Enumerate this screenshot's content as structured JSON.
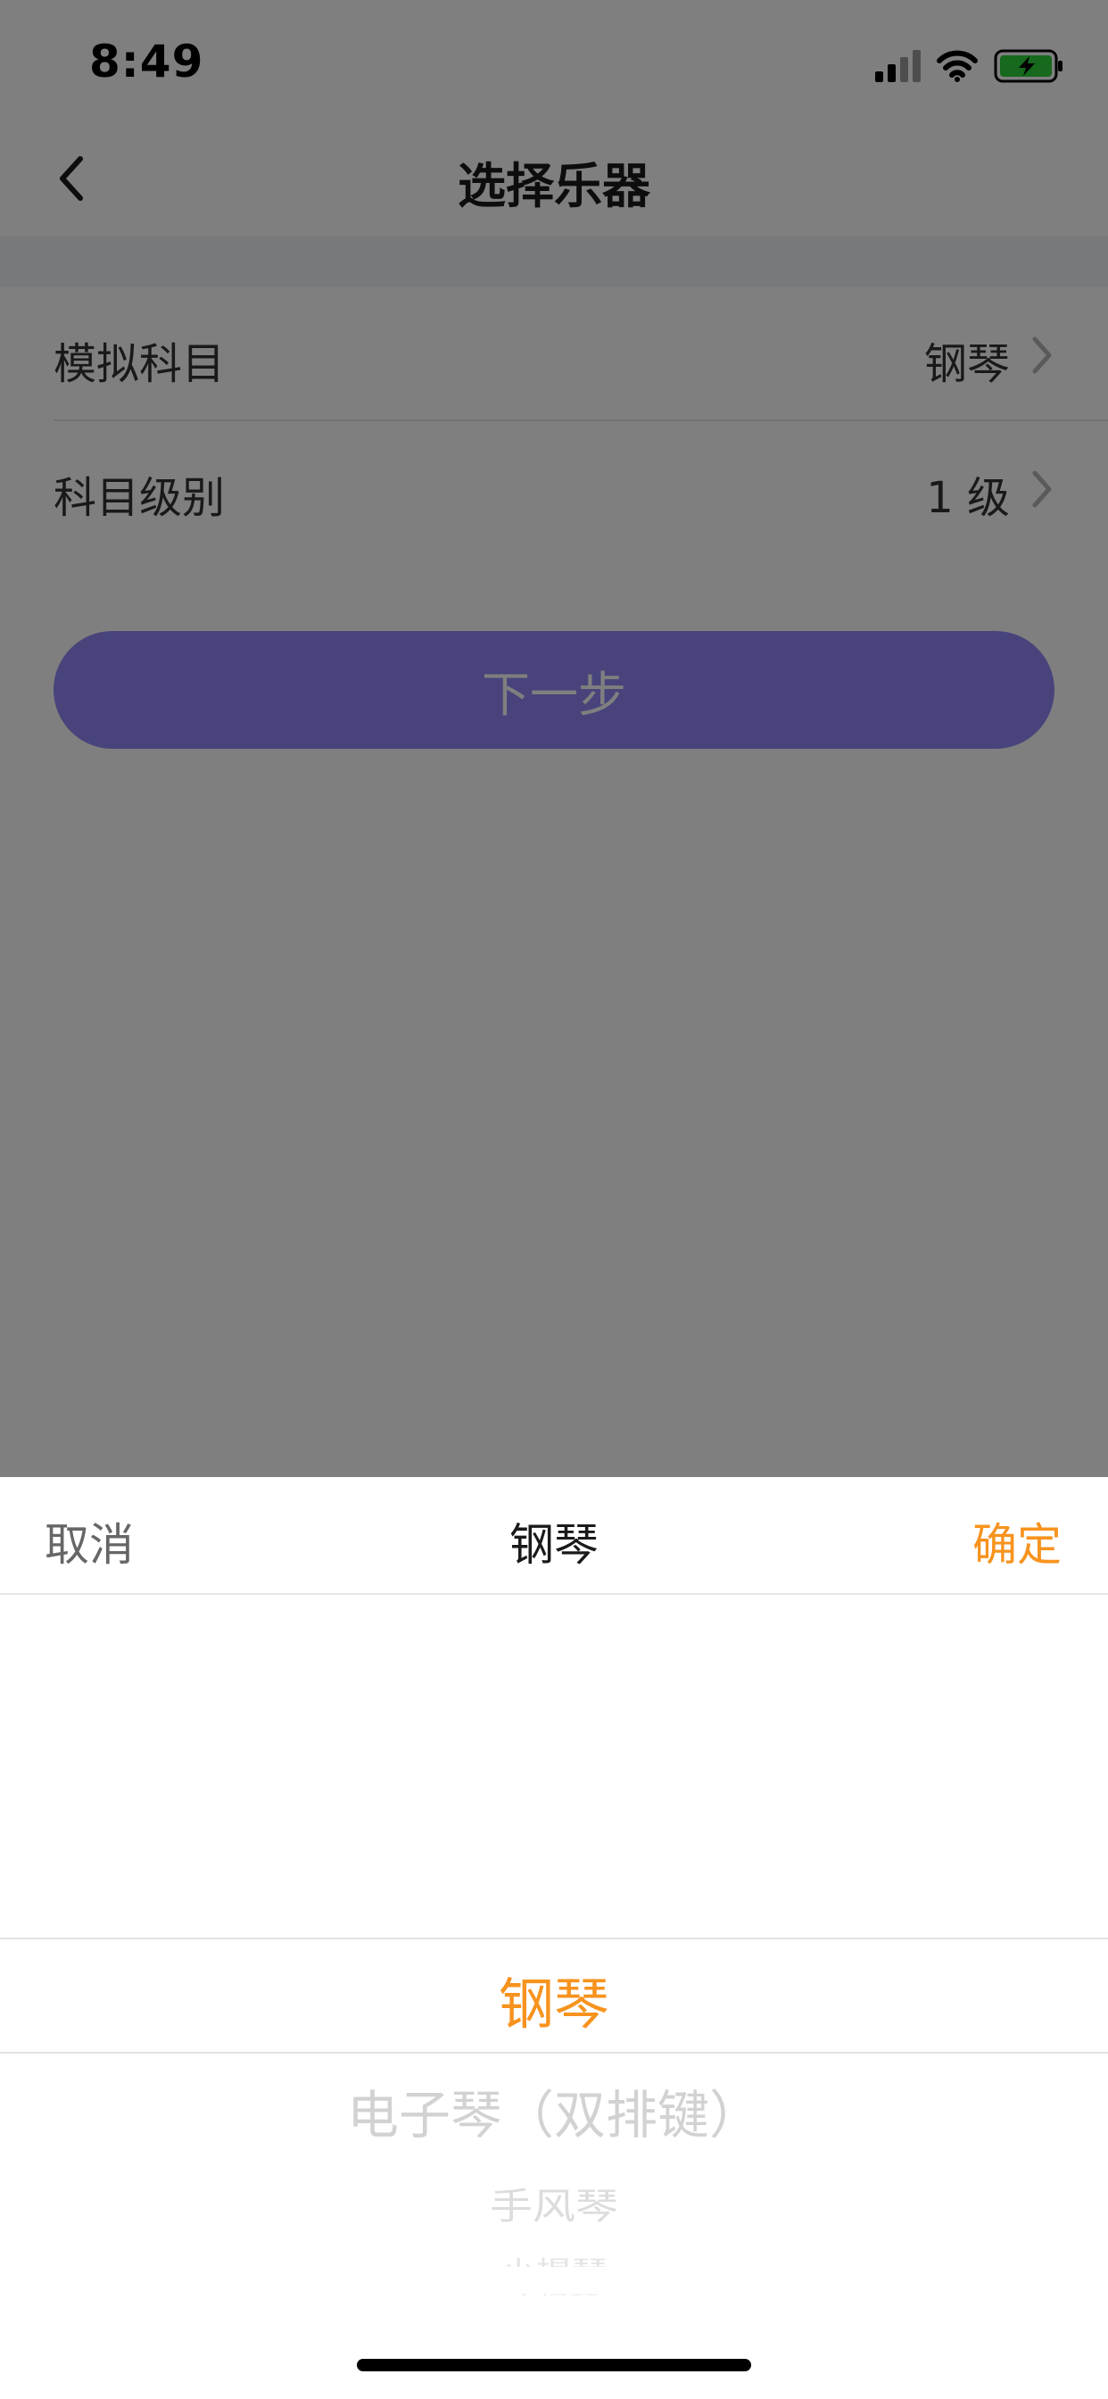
{
  "status_bar": {
    "time": "8:49",
    "battery_color": "#2dd23a"
  },
  "nav": {
    "title": "选择乐器",
    "back_icon": "chevron-left-icon"
  },
  "form": {
    "rows": [
      {
        "label": "模拟科目",
        "value": "钢琴"
      },
      {
        "label": "科目级别",
        "value": "1 级"
      }
    ],
    "next_button": "下一步",
    "button_color": "#9089f6"
  },
  "picker": {
    "cancel": "取消",
    "title": "钢琴",
    "confirm": "确定",
    "accent_color": "#f7931e",
    "selected": "钢琴",
    "options": [
      "钢琴",
      "电子琴（双排键）",
      "手风琴",
      "小提琴",
      "大提琴"
    ]
  }
}
